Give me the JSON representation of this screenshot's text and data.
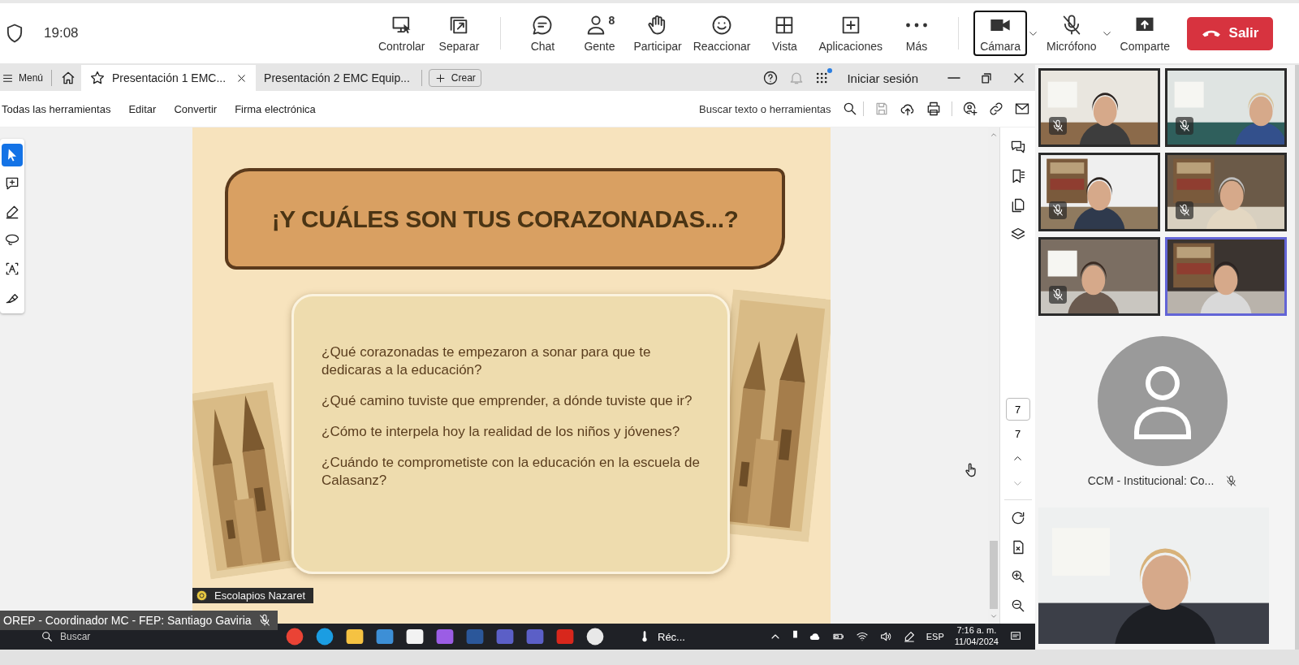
{
  "meeting_bar": {
    "time": "19:08",
    "button_groups": [
      [
        {
          "kind": "control",
          "label": "Controlar",
          "selected": false,
          "dropdown": false
        },
        {
          "kind": "popout",
          "label": "Separar",
          "selected": false,
          "dropdown": false
        }
      ],
      [
        {
          "kind": "chat",
          "label": "Chat",
          "selected": false,
          "dropdown": false
        },
        {
          "kind": "people",
          "label": "Gente",
          "count": "8",
          "selected": false,
          "dropdown": false
        },
        {
          "kind": "hand",
          "label": "Participar",
          "selected": false,
          "dropdown": false
        },
        {
          "kind": "smile",
          "label": "Reaccionar",
          "selected": false,
          "dropdown": false
        },
        {
          "kind": "grid",
          "label": "Vista",
          "selected": false,
          "dropdown": false
        },
        {
          "kind": "plusbox",
          "label": "Aplicaciones",
          "selected": false,
          "dropdown": false
        },
        {
          "kind": "more",
          "label": "Más",
          "selected": false,
          "dropdown": false
        }
      ],
      [
        {
          "kind": "camera",
          "label": "Cámara",
          "selected": true,
          "dropdown": true
        },
        {
          "kind": "micoff",
          "label": "Micrófono",
          "selected": false,
          "dropdown": true
        },
        {
          "kind": "share",
          "label": "Comparte",
          "selected": false,
          "dropdown": false
        }
      ]
    ],
    "leave": "Salir"
  },
  "viewer": {
    "menu": "Menú",
    "tabs": [
      {
        "label": "Presentación 1 EMC...",
        "selected": true
      },
      {
        "label": "Presentación 2 EMC Equip...",
        "selected": false
      }
    ],
    "create": "Crear",
    "sign_in": "Iniciar sesión",
    "tools_menu": [
      "Todas las herramientas",
      "Editar",
      "Convertir",
      "Firma electrónica"
    ],
    "search_placeholder": "Buscar texto o herramientas",
    "left_tools": [
      {
        "kind": "pointer",
        "selected": true
      },
      {
        "kind": "commentplus",
        "selected": false
      },
      {
        "kind": "pen",
        "selected": false
      },
      {
        "kind": "lasso",
        "selected": false
      },
      {
        "kind": "textselect",
        "selected": false
      },
      {
        "kind": "sign",
        "selected": false
      }
    ],
    "page_number": "7",
    "page_count": "7"
  },
  "slide": {
    "title": "¡Y CUÁLES SON TUS CORAZONADAS...?",
    "questions": [
      "¿Qué corazonadas te empezaron a sonar para que te dedicaras a la educación?",
      "¿Qué camino tuviste que emprender,  a dónde tuviste que ir?",
      "¿Cómo te interpela hoy la realidad de los niños y jóvenes?",
      "¿Cuándo te comprometiste con la educación en la escuela de Calasanz?"
    ],
    "brand": "Escolapios Nazaret"
  },
  "presenter": {
    "name": "OREP - Coordinador MC - FEP: Santiago Gaviria",
    "muted": true
  },
  "taskbar": {
    "search": "Buscar",
    "weather": "Réc...",
    "language": "ESP",
    "time": "7:16 a. m.",
    "date": "11/04/2024"
  },
  "gallery": {
    "tiles": [
      {
        "muted": true,
        "selected": false
      },
      {
        "muted": true,
        "selected": false
      },
      {
        "muted": true,
        "selected": false
      },
      {
        "muted": true,
        "selected": false
      },
      {
        "muted": true,
        "selected": false
      },
      {
        "muted": false,
        "selected": true
      }
    ],
    "placeholder": {
      "name": "CCM - Institucional: Co...",
      "muted": true
    },
    "featured": {
      "muted": false
    }
  }
}
